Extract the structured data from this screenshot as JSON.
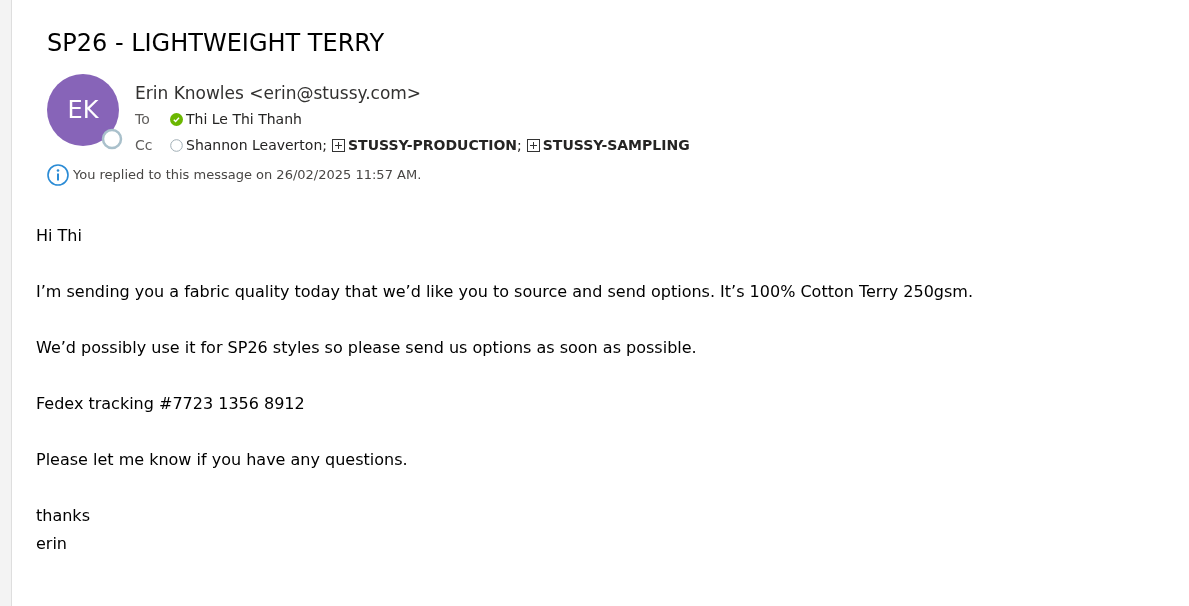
{
  "subject": "SP26 - LIGHTWEIGHT TERRY",
  "sender": {
    "initials": "EK",
    "name": "Erin Knowles <erin@stussy.com>"
  },
  "to": {
    "label": "To",
    "recipients": [
      {
        "kind": "person",
        "available": true,
        "name": "Thi Le Thi Thanh"
      }
    ]
  },
  "cc": {
    "label": "Cc",
    "recipients": [
      {
        "kind": "person",
        "available": false,
        "name": "Shannon Leaverton",
        "separator": ";"
      },
      {
        "kind": "group",
        "name": "STUSSY-PRODUCTION",
        "separator": ";"
      },
      {
        "kind": "group",
        "name": "STUSSY-SAMPLING"
      }
    ]
  },
  "info": "You replied to this message on 26/02/2025 11:57 AM.",
  "body": [
    [
      "Hi Thi"
    ],
    [
      "I’m sending you a fabric quality today that we’d like you to source and send options.  It’s 100% Cotton Terry 250gsm."
    ],
    [
      "We’d possibly use it for SP26 styles so please send us options as soon as possible."
    ],
    [
      "Fedex tracking #7723 1356 8912"
    ],
    [
      "Please let me know if you have any questions."
    ],
    [
      "thanks",
      "erin"
    ]
  ]
}
